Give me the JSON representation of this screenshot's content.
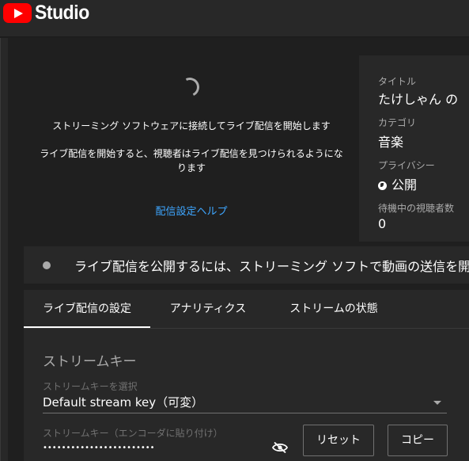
{
  "app": {
    "logo_text": "Studio"
  },
  "preview": {
    "message_1": "ストリーミング ソフトウェアに接続してライブ配信を開始します",
    "message_2": "ライブ配信を開始すると、視聴者はライブ配信を見つけられるようになります",
    "help_link": "配信設定ヘルプ"
  },
  "info": {
    "title_label": "タイトル",
    "title_value": "たけしゃん の",
    "category_label": "カテゴリ",
    "category_value": "音楽",
    "privacy_label": "プライバシー",
    "privacy_value": "公開",
    "privacy_icon": "globe-icon",
    "waiting_label": "待機中の視聴者数",
    "waiting_value": "0"
  },
  "banner": {
    "text": "ライブ配信を公開するには、ストリーミング ソフトで動画の送信を開"
  },
  "tabs": [
    {
      "label": "ライブ配信の設定",
      "active": true
    },
    {
      "label": "アナリティクス",
      "active": false
    },
    {
      "label": "ストリームの状態",
      "active": false
    }
  ],
  "stream_settings": {
    "section_title": "ストリームキー",
    "select_label": "ストリームキーを選択",
    "select_value": "Default stream key（可変）",
    "key_label": "ストリームキー（エンコーダに貼り付け）",
    "key_masked": "••••••••••••••••••••••••",
    "visibility_icon": "eye-off-icon",
    "reset_button": "リセット",
    "copy_button": "コピー"
  },
  "colors": {
    "accent_link": "#3ea6ff",
    "brand_red": "#ff0000"
  }
}
